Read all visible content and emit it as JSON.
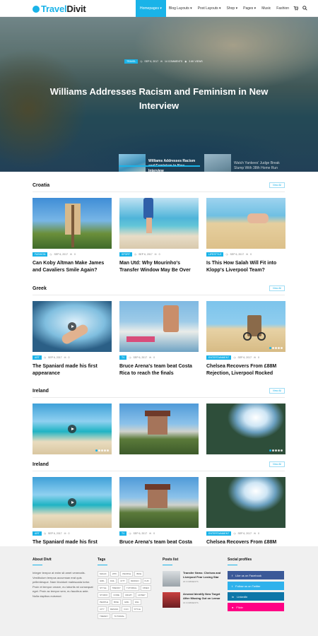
{
  "brand": {
    "name_a": "Travel",
    "name_b": "Divit"
  },
  "nav": [
    "Homepages",
    "Blog Layouts",
    "Post Layouts",
    "Shop",
    "Pages",
    "Music",
    "Fashion"
  ],
  "hero": {
    "tag": "TRAVEL",
    "date": "SEP 6, 2017",
    "comments": "14 COMMENTS",
    "views": "3.6K VIEWS",
    "title": "Williams Addresses Racism and Feminism in New Interview",
    "thumbs": [
      {
        "title": "Williams Addresses Racism and Feminism in New Interview"
      },
      {
        "title": "Watch Yankees' Judge Break Slump With 38th Home Run"
      }
    ]
  },
  "sections": [
    {
      "title": "Croatia",
      "view_all": "View All",
      "cards": [
        {
          "tag": "FASHION",
          "date": "SEP 6, 2017",
          "count": "0",
          "title": "Can Koby Altman Make James and Cavaliers Smile Again?"
        },
        {
          "tag": "SPORT",
          "date": "SEP 6, 2017",
          "count": "0",
          "title": "Man Utd: Why Mourinho's Transfer Window May Be Over"
        },
        {
          "tag": "LIFESTYLE",
          "date": "SEP 6, 2017",
          "count": "0",
          "title": "Is This How Salah Will Fit into Klopp's Liverpool Team?"
        }
      ]
    },
    {
      "title": "Greek",
      "view_all": "View All",
      "cards": [
        {
          "tag": "ART",
          "date": "SEP 6, 2017",
          "count": "0",
          "title": "The Spaniard made his first appearance"
        },
        {
          "tag": "TV",
          "date": "SEP 6, 2017",
          "count": "0",
          "title": "Bruce Arena's team beat Costa Rica to reach the finals"
        },
        {
          "tag": "ENTERTAINMENT",
          "date": "SEP 6, 2017",
          "count": "0",
          "title": "Chelsea Recovers From £88M Rejection, Liverpool Rocked"
        }
      ]
    },
    {
      "title": "Ireland",
      "view_all": "View All",
      "cards": [
        {
          "tag": "",
          "date": "",
          "count": "",
          "title": ""
        },
        {
          "tag": "",
          "date": "",
          "count": "",
          "title": ""
        },
        {
          "tag": "",
          "date": "",
          "count": "",
          "title": ""
        }
      ]
    },
    {
      "title": "Ireland",
      "view_all": "View All",
      "cards": [
        {
          "tag": "ART",
          "date": "SEP 6, 2017",
          "count": "0",
          "title": "The Spaniard made his first appearance"
        },
        {
          "tag": "TV",
          "date": "SEP 6, 2017",
          "count": "0",
          "title": "Bruce Arena's team beat Costa Rica to reach the finals"
        },
        {
          "tag": "ENTERTAINMENT",
          "date": "SEP 6, 2017",
          "count": "0",
          "title": "Chelsea Recovers From £88M Rejection, Liverpool Rocked"
        }
      ]
    }
  ],
  "footer": {
    "about_title": "About Divit",
    "about_text": "Integer tempor at enim sit amet venenatis. Vestibulum tempus accumsan erat quis pellentesque. Nam tincidunt malesuada tortor. Proin et tempor ornare, eu lobortis mi consequat eget. Proin ac tempor sem, eu faucibus ante. Nulla dapibus euismod.",
    "tags_title": "Tags",
    "tags": [
      "MAGIC",
      "WTF",
      "PEOPLE",
      "BIKE",
      "GIRL",
      "FAIL",
      "CITY",
      "DESIGN",
      "FUN",
      "STYLE",
      "TRENDY",
      "TUTORIAL",
      "VIDEO",
      "STUDIO",
      "CODE",
      "CRAZY",
      "HONEY",
      "PEOPLE",
      "BIKE",
      "GIRL",
      "FAIL",
      "CITY",
      "DESIGN",
      "FUN",
      "STYLE",
      "TRENDY",
      "TUTORIAL"
    ],
    "posts_title": "Posts list",
    "posts": [
      {
        "title": "Transfer News: Chelsea and Liverpool Fear Losing Star",
        "meta": "20 COMMENTS"
      },
      {
        "title": "Arsenal Identify New Target After Missing Out on Lemar",
        "meta": "16 COMMENTS"
      }
    ],
    "social_title": "Social profiles",
    "social": [
      {
        "label": "Like us on Facebook",
        "color": "#3b5998"
      },
      {
        "label": "Follow us on Twitter",
        "color": "#2fb2ec"
      },
      {
        "label": "LinkedIn",
        "color": "#0e76a8"
      },
      {
        "label": "Flickr",
        "color": "#ff0084"
      }
    ]
  },
  "colors": {
    "accent": "#1ab3e8"
  }
}
